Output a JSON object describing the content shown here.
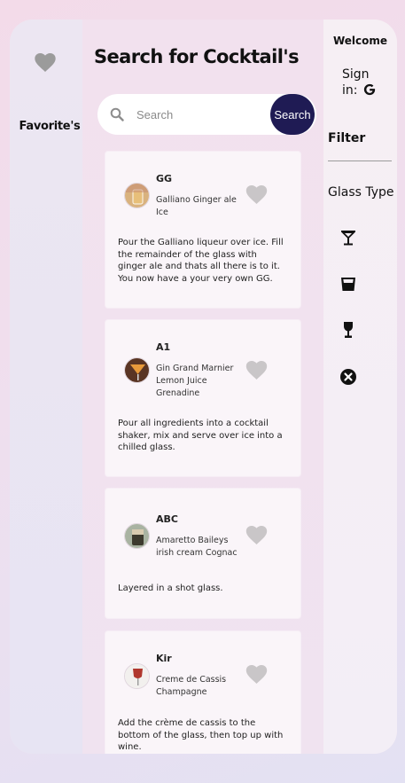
{
  "sidebar": {
    "favorites_label": "Favorite's",
    "favorites_icon": "heart-icon"
  },
  "main": {
    "title": "Search for Cocktail's",
    "search": {
      "placeholder": "Search",
      "value": "",
      "button_label": "Search",
      "icon": "search-icon"
    },
    "cocktails": [
      {
        "name": "GG",
        "ingredients": [
          "Galliano Ginger ale",
          "Ice"
        ],
        "description": "Pour the Galliano liqueur over ice. Fill the remainder of the glass with ginger ale and thats all there is to it. You now have a your very own GG.",
        "favorite_icon": "heart-icon",
        "thumb_colors": [
          "#e8b866",
          "#c98a5a"
        ]
      },
      {
        "name": "A1",
        "ingredients": [
          "Gin Grand Marnier",
          "Lemon Juice",
          "Grenadine"
        ],
        "description": "Pour all ingredients into a cocktail shaker, mix and serve over ice into a chilled glass.",
        "favorite_icon": "heart-icon",
        "thumb_colors": [
          "#e89a3b",
          "#5a3524"
        ]
      },
      {
        "name": "ABC",
        "ingredients": [
          "Amaretto Baileys",
          "irish cream Cognac"
        ],
        "description": "Layered in a shot glass.",
        "favorite_icon": "heart-icon",
        "thumb_colors": [
          "#7c8a74",
          "#3d3a2e"
        ]
      },
      {
        "name": "Kir",
        "ingredients": [
          "Creme de Cassis",
          "Champagne"
        ],
        "description": "Add the crème de cassis to the bottom of the glass, then top up with wine.",
        "favorite_icon": "heart-icon",
        "thumb_colors": [
          "#b0372e",
          "#f2f0ee"
        ]
      }
    ]
  },
  "right_panel": {
    "welcome": "Welcome",
    "sign_in_label": "Sign in:",
    "sign_in_icon": "google-icon",
    "filter_label": "Filter",
    "glass_type_label": "Glass Type",
    "glass_filters": [
      {
        "icon": "cocktail-glass-icon"
      },
      {
        "icon": "old-fashioned-glass-icon"
      },
      {
        "icon": "wine-glass-icon"
      },
      {
        "icon": "clear-filter-icon"
      }
    ]
  },
  "colors": {
    "accent": "#1f1b54",
    "heart_inactive": "#c9c6c8"
  }
}
